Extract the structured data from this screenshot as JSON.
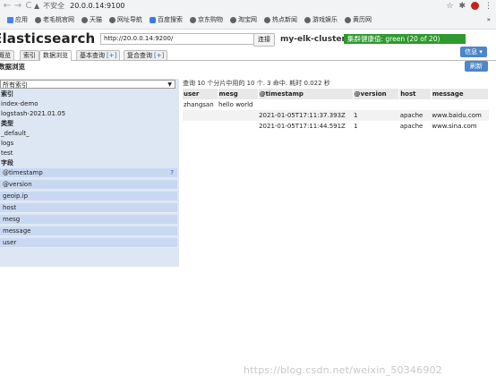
{
  "browser": {
    "security_label": "不安全",
    "url": "20.0.0.14:9100",
    "bookmarks": [
      {
        "label": "应用",
        "icon": "apps-grid-icon"
      },
      {
        "label": "老毛桃官网",
        "icon": "globe-icon"
      },
      {
        "label": "天猫",
        "icon": "globe-icon"
      },
      {
        "label": "网址导航",
        "icon": "globe-icon"
      },
      {
        "label": "百度搜索",
        "icon": "baidu-icon"
      },
      {
        "label": "京东购物",
        "icon": "globe-icon"
      },
      {
        "label": "淘宝网",
        "icon": "globe-icon"
      },
      {
        "label": "热点新闻",
        "icon": "globe-icon"
      },
      {
        "label": "游戏娱乐",
        "icon": "globe-icon"
      },
      {
        "label": "黄历网",
        "icon": "globe-icon"
      }
    ],
    "bookmarks_more": "»"
  },
  "app": {
    "brand": "Elasticsearch",
    "connect_url": "http://20.0.0.14:9200/",
    "connect_button": "连接",
    "cluster_name": "my-elk-cluster",
    "health": "集群健康值: green (20 of 20)",
    "health_color": "#2e9a2e",
    "info_button": "信息 ▾",
    "tabs": [
      {
        "label": "概览"
      },
      {
        "label": "索引"
      },
      {
        "label": "数据浏览",
        "active": true
      },
      {
        "label": "基本查询",
        "plus": "[+]"
      },
      {
        "label": "复合查询",
        "plus": "[+]"
      }
    ],
    "section_title": "数据浏览",
    "refresh_button": "刷新"
  },
  "sidebar": {
    "index_select": "所有索引",
    "headers": {
      "index": "索引",
      "type": "类型",
      "field": "字段"
    },
    "indices": [
      "index-demo",
      "logstash-2021.01.05"
    ],
    "types": [
      "_default_",
      "logs",
      "test"
    ],
    "fields": [
      "@timestamp",
      "@version",
      "geoip.ip",
      "host",
      "mesg",
      "message",
      "user"
    ],
    "field_help": "?"
  },
  "results": {
    "summary": "查询 10 个分片中用的 10 个. 3 命中. 耗时 0.022 秒",
    "columns": [
      "user",
      "mesg",
      "@timestamp",
      "@version",
      "host",
      "message"
    ],
    "rows": [
      [
        "zhangsan",
        "hello world",
        "",
        "",
        "",
        ""
      ],
      [
        "",
        "",
        "2021-01-05T17:11:37.393Z",
        "1",
        "apache",
        "www.baidu.com"
      ],
      [
        "",
        "",
        "2021-01-05T17:11:44.591Z",
        "1",
        "apache",
        "www.sina.com"
      ]
    ]
  },
  "watermark": "https://blog.csdn.net/weixin_50346902"
}
